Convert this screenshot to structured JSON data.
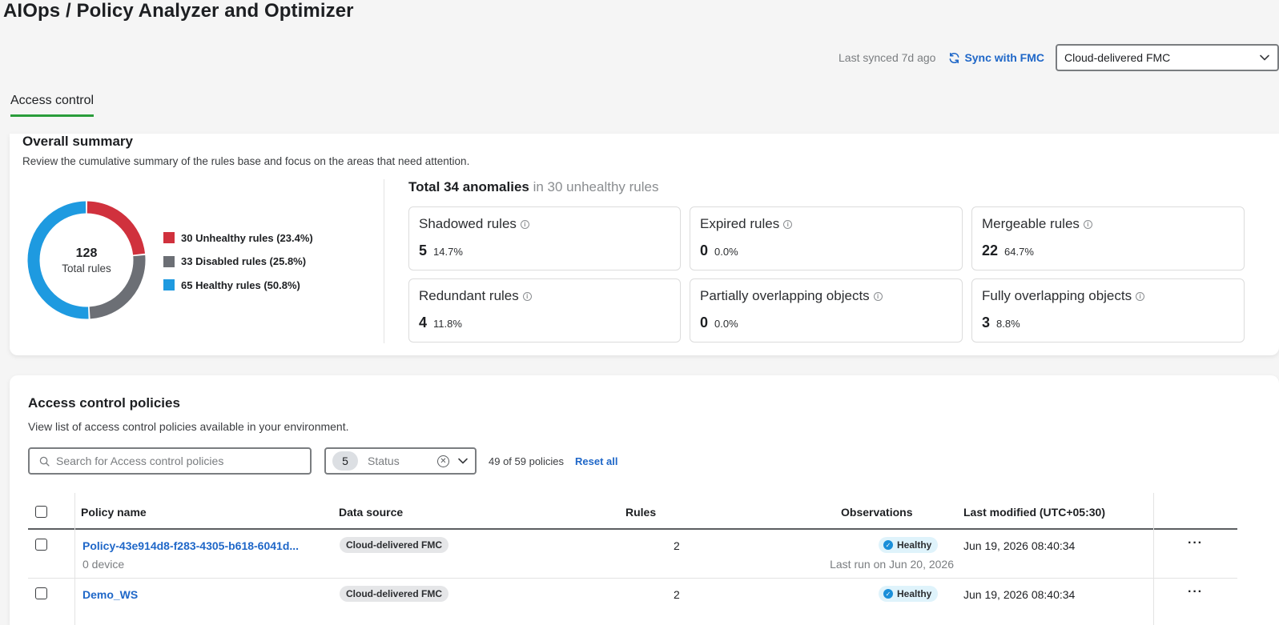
{
  "header": {
    "title": "AIOps / Policy Analyzer and Optimizer",
    "last_synced": "Last synced 7d ago",
    "sync_label": "Sync with FMC",
    "fmc_select_value": "Cloud-delivered FMC"
  },
  "tabs": [
    {
      "label": "Access control",
      "active": true
    }
  ],
  "summary": {
    "title": "Overall summary",
    "description": "Review the cumulative summary of the rules base and focus on the areas that need attention.",
    "total_count": "128",
    "total_label": "Total rules",
    "legend": [
      {
        "label": "30 Unhealthy rules (23.4%)",
        "value": 30,
        "color": "#d0313d"
      },
      {
        "label": "33 Disabled rules (25.8%)",
        "value": 33,
        "color": "#6c6f75"
      },
      {
        "label": "65 Healthy rules (50.8%)",
        "value": 65,
        "color": "#1e9ae0"
      }
    ],
    "anomalies_strong": "Total 34 anomalies",
    "anomalies_muted": "in 30 unhealthy rules",
    "metrics": [
      {
        "name": "Shadowed rules",
        "count": "5",
        "percent": "14.7%"
      },
      {
        "name": "Expired rules",
        "count": "0",
        "percent": "0.0%"
      },
      {
        "name": "Mergeable rules",
        "count": "22",
        "percent": "64.7%"
      },
      {
        "name": "Redundant rules",
        "count": "4",
        "percent": "11.8%"
      },
      {
        "name": "Partially overlapping objects",
        "count": "0",
        "percent": "0.0%"
      },
      {
        "name": "Fully overlapping objects",
        "count": "3",
        "percent": "8.8%"
      }
    ]
  },
  "policies": {
    "title": "Access control policies",
    "description": "View list of access control policies available in your environment.",
    "search_placeholder": "Search for Access control policies",
    "status_count": "5",
    "status_placeholder": "Status",
    "policy_count": "49 of 59 policies",
    "reset_label": "Reset all",
    "columns": {
      "name": "Policy name",
      "source": "Data source",
      "rules": "Rules",
      "observations": "Observations",
      "modified": "Last modified (UTC+05:30)"
    },
    "rows": [
      {
        "name": "Policy-43e914d8-f283-4305-b618-6041d...",
        "devices": "0 device",
        "source": "Cloud-delivered FMC",
        "rules": "2",
        "status": "Healthy",
        "last_run": "Last run on Jun 20, 2026",
        "modified": "Jun 19, 2026 08:40:34"
      },
      {
        "name": "Demo_WS",
        "devices": "",
        "source": "Cloud-delivered FMC",
        "rules": "2",
        "status": "Healthy",
        "last_run": "",
        "modified": "Jun 19, 2026 08:40:34"
      }
    ]
  },
  "icons": {
    "sync": "sync-icon",
    "chevron": "chevron-down-icon",
    "search": "search-icon",
    "info": "info-icon",
    "clear": "clear-icon",
    "check": "check-circle-icon",
    "more": "more-icon"
  }
}
